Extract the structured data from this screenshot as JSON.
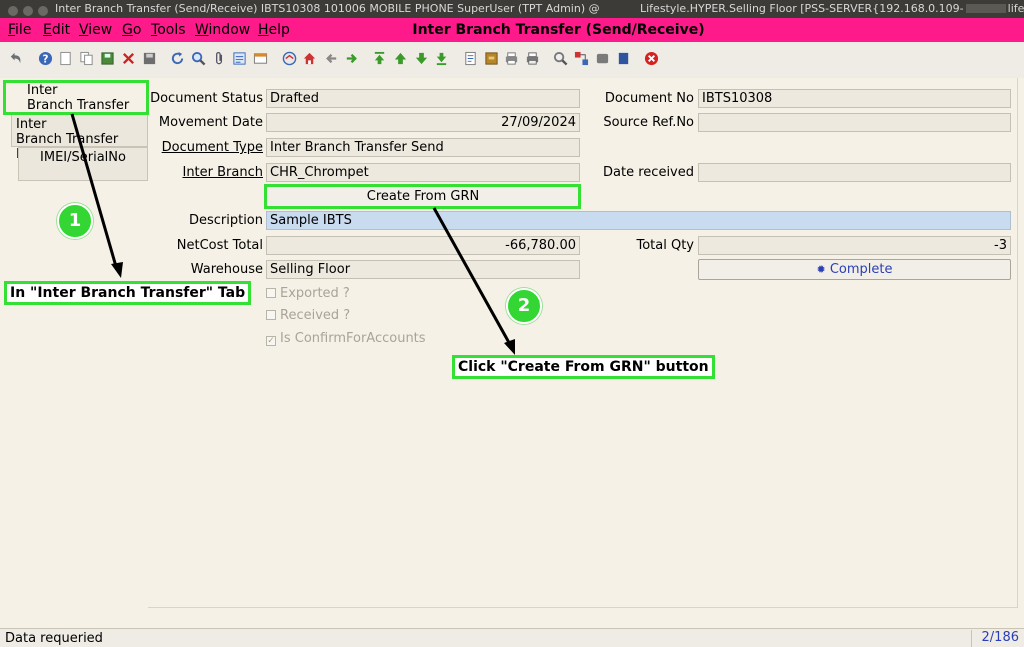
{
  "window": {
    "title_left": "Inter Branch Transfer (Send/Receive)  IBTS10308  101006  MOBILE PHONE  SuperUser (TPT Admin) @",
    "title_right": "Lifestyle.HYPER.Selling Floor [PSS-SERVER{192.168.0.109-",
    "title_suffix": "lifes"
  },
  "menubar": {
    "items": [
      {
        "key": "F",
        "rest": "ile"
      },
      {
        "key": "E",
        "rest": "dit"
      },
      {
        "key": "V",
        "rest": "iew"
      },
      {
        "key": "G",
        "rest": "o"
      },
      {
        "key": "T",
        "rest": "ools"
      },
      {
        "key": "W",
        "rest": "indow"
      },
      {
        "key": "H",
        "rest": "elp"
      }
    ],
    "window_title": "Inter Branch Transfer (Send/Receive)"
  },
  "toolbar": {
    "icons": [
      "undo-icon",
      "help-icon",
      "new-icon",
      "copy-icon",
      "save-icon",
      "delete-icon",
      "save-disk-icon",
      "refresh-icon",
      "find-icon",
      "attachment-icon",
      "history-icon",
      "grid-toggle-icon",
      "home-icon",
      "home-alt-icon",
      "back-icon",
      "forward-icon",
      "first-record-icon",
      "previous-record-icon",
      "next-record-icon",
      "last-record-icon",
      "report-icon",
      "archive-icon",
      "print-preview-icon",
      "print-icon",
      "zoom-across-icon",
      "workflow-icon",
      "request-icon",
      "product-info-icon",
      "close-window-icon"
    ]
  },
  "tabs": [
    {
      "line1": "Inter",
      "line2": "Branch Transfer"
    },
    {
      "line1": "Inter",
      "line2": "Branch Transfer Line"
    },
    {
      "line1": "IMEI/SerialNo",
      "line2": ""
    }
  ],
  "form": {
    "document_status": {
      "label": "Document Status",
      "value": "Drafted"
    },
    "document_no": {
      "label": "Document No",
      "value": "IBTS10308"
    },
    "movement_date": {
      "label": "Movement Date",
      "value": "27/09/2024"
    },
    "source_ref_no": {
      "label": "Source Ref.No",
      "value": ""
    },
    "document_type": {
      "label": "Document Type",
      "value": "Inter Branch Transfer Send"
    },
    "inter_branch": {
      "label": "Inter Branch",
      "value": "CHR_Chrompet"
    },
    "date_received": {
      "label": "Date received",
      "value": ""
    },
    "create_from_grn": {
      "label": "Create From GRN"
    },
    "description": {
      "label": "Description",
      "value": "Sample IBTS"
    },
    "netcost_total": {
      "label": "NetCost Total",
      "value": "-66,780.00"
    },
    "total_qty": {
      "label": "Total Qty",
      "value": "-3"
    },
    "warehouse": {
      "label": "Warehouse",
      "value": "Selling Floor"
    },
    "complete": {
      "label": "Complete"
    },
    "exported": {
      "label": "Exported ?"
    },
    "received": {
      "label": "Received ?"
    },
    "confirm_accounts": {
      "label": "Is ConfirmForAccounts"
    }
  },
  "annotations": {
    "step1_number": "1",
    "step1_text": "In \"Inter Branch Transfer\" Tab",
    "step2_number": "2",
    "step2_text": "Click \"Create From GRN\" button",
    "color": "#33e033"
  },
  "statusbar": {
    "message": "Data requeried",
    "record": "2/186"
  },
  "colors": {
    "menubar": "#ff1a8c",
    "panel": "#f5f1e6",
    "description_field": "#c9dbef",
    "link": "#2a3fb5"
  }
}
